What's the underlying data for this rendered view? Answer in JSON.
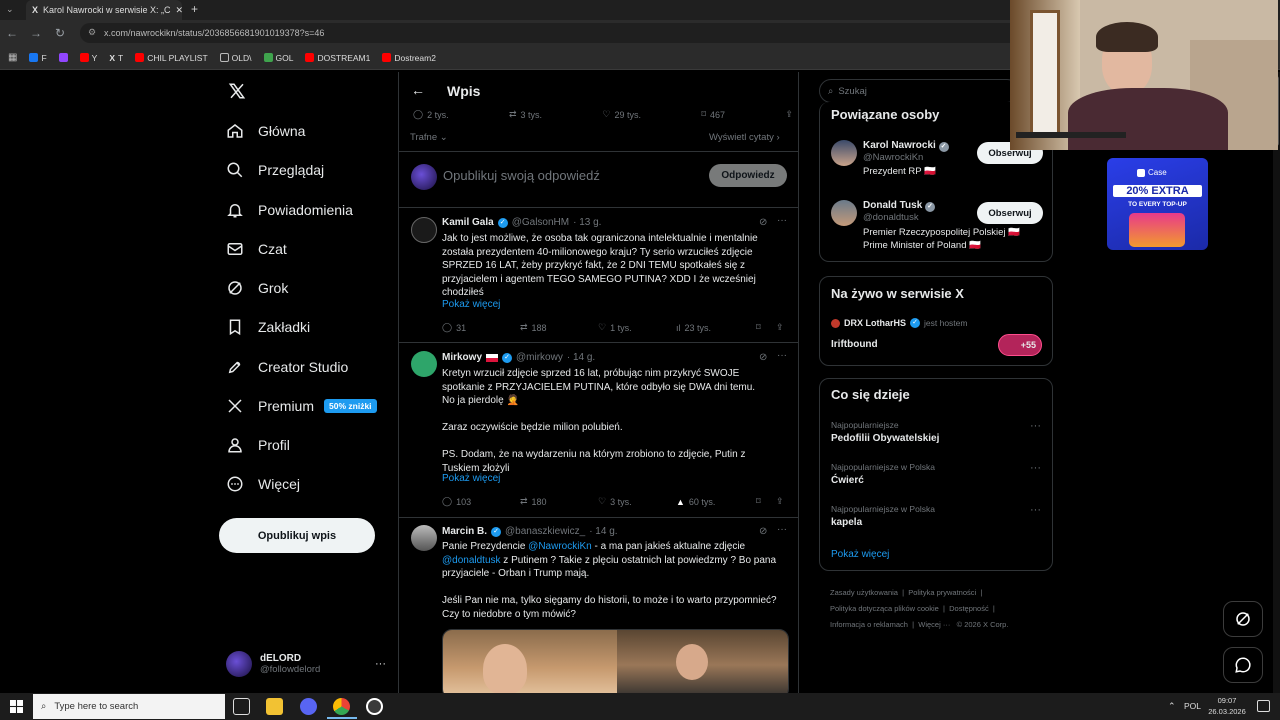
{
  "browser": {
    "tab_title": "Karol Nawrocki w serwisie X: „C",
    "url": "x.com/nawrockikn/status/2036856681901019378?s=46",
    "bookmarks": [
      "F",
      "Y",
      "T",
      "CHIL PLAYLIST",
      "OLD\\",
      "GOL",
      "DOSTREAM1",
      "Dostream2"
    ]
  },
  "nav": {
    "items": [
      {
        "label": "Główna",
        "icon": "home-icon"
      },
      {
        "label": "Przeglądaj",
        "icon": "search-icon"
      },
      {
        "label": "Powiadomienia",
        "icon": "bell-icon"
      },
      {
        "label": "Czat",
        "icon": "mail-icon"
      },
      {
        "label": "Grok",
        "icon": "grok-icon"
      },
      {
        "label": "Zakładki",
        "icon": "bookmark-icon"
      },
      {
        "label": "Creator Studio",
        "icon": "rocket-icon"
      },
      {
        "label": "Premium",
        "icon": "x-logo-icon"
      },
      {
        "label": "Profil",
        "icon": "person-icon"
      },
      {
        "label": "Więcej",
        "icon": "more-circle-icon"
      }
    ],
    "premium_badge": "50% zniżki",
    "post_button": "Opublikuj wpis",
    "account": {
      "name": "dELORD",
      "handle": "@followdelord"
    }
  },
  "main": {
    "title": "Wpis",
    "stats": {
      "replies": "2 tys.",
      "reposts": "3 tys.",
      "likes": "29 tys.",
      "bookmarks": "467"
    },
    "sort_label": "Trafne",
    "quotes_link": "Wyświetl cytaty",
    "reply_placeholder": "Opublikuj swoją odpowiedź",
    "reply_button": "Odpowiedz",
    "tweets": [
      {
        "name": "Kamil Gala",
        "handle": "@GalsonHM",
        "time": "· 13 g.",
        "text": "Jak to jest możliwe, że osoba tak ograniczona intelektualnie i mentalnie została prezydentem 40-milionowego kraju? Ty serio wrzuciłeś zdjęcie SPRZED 16 LAT, żeby przykryć fakt, że 2 DNI TEMU spotkałeś się z przyjacielem i agentem TEGO SAMEGO PUTINA? XDD I że wcześniej chodziłeś",
        "more": "Pokaż więcej",
        "replies": "31",
        "reposts": "188",
        "likes": "1 tys.",
        "views": "23 tys."
      },
      {
        "name": "Mirkowy",
        "handle": "@mirkowy",
        "time": "· 14 g.",
        "text": "Kretyn wrzucił zdjęcie sprzed 16 lat, próbując nim przykryć SWOJE spotkanie z PRZYJACIELEM PUTINA, które odbyło się DWA dni temu.\nNo ja pierdolę 🤦\n\nZaraz oczywiście będzie milion polubień.\n\nPS. Dodam, że na wydarzeniu na którym zrobiono to zdjęcie, Putin z Tuskiem złożyli",
        "more": "Pokaż więcej",
        "replies": "103",
        "reposts": "180",
        "likes": "3 tys.",
        "views": "60 tys."
      },
      {
        "name": "Marcin B.",
        "handle": "@banaszkiewicz_",
        "time": "· 14 g.",
        "text_a": "Panie Prezydencie ",
        "mention1": "@NawrockiKn",
        "text_b": " - a ma pan jakieś aktualne zdjęcie ",
        "mention2": "@donaldtusk",
        "text_c": " z Putinem ? Takie z plęciu ostatnich lat powiedzmy ? Bo pana przyjaciele - Orban i Trump mają.",
        "text_d": "Jeśli Pan nie ma, tylko sięgamy do historii, to może i to warto przypomnieć? Czy to niedobre o tym mówić?"
      }
    ]
  },
  "right": {
    "search_placeholder": "Szukaj",
    "related_title": "Powiązane osoby",
    "people": [
      {
        "name": "Karol Nawrocki",
        "handle": "@NawrockiKn",
        "bio": "Prezydent RP 🇵🇱",
        "button": "Obserwuj"
      },
      {
        "name": "Donald Tusk",
        "handle": "@donaldtusk",
        "bio": "Premier Rzeczypospolitej Polskiej 🇵🇱 Prime Minister of Poland 🇵🇱",
        "button": "Obserwuj"
      }
    ],
    "live_title": "Na żywo w serwisie X",
    "live_host": "DRX LotharHS",
    "live_host_suffix": "jest hostem",
    "live_name": "Iriftbound",
    "live_count": "+55",
    "trends_title": "Co się dzieje",
    "trends": [
      {
        "meta": "Najpopularniejsze",
        "name": "Pedofilii Obywatelskiej"
      },
      {
        "meta": "Najpopularniejsze w Polska",
        "name": "Ćwierć"
      },
      {
        "meta": "Najpopularniejsze w Polska",
        "name": "kapela"
      }
    ],
    "show_more": "Pokaż więcej",
    "footer": [
      "Zasady użytkowania",
      "Polityka prywatności",
      "Polityka dotycząca plików cookie",
      "Dostępność",
      "Informacja o reklamach",
      "Więcej ···",
      "© 2026 X Corp."
    ]
  },
  "ad": {
    "brand": "Case",
    "headline": "20% EXTRA",
    "sub": "TO EVERY TOP-UP"
  },
  "taskbar": {
    "search_placeholder": "Type here to search",
    "lang": "POL",
    "time": "09:07",
    "date": "26.03.2026"
  }
}
